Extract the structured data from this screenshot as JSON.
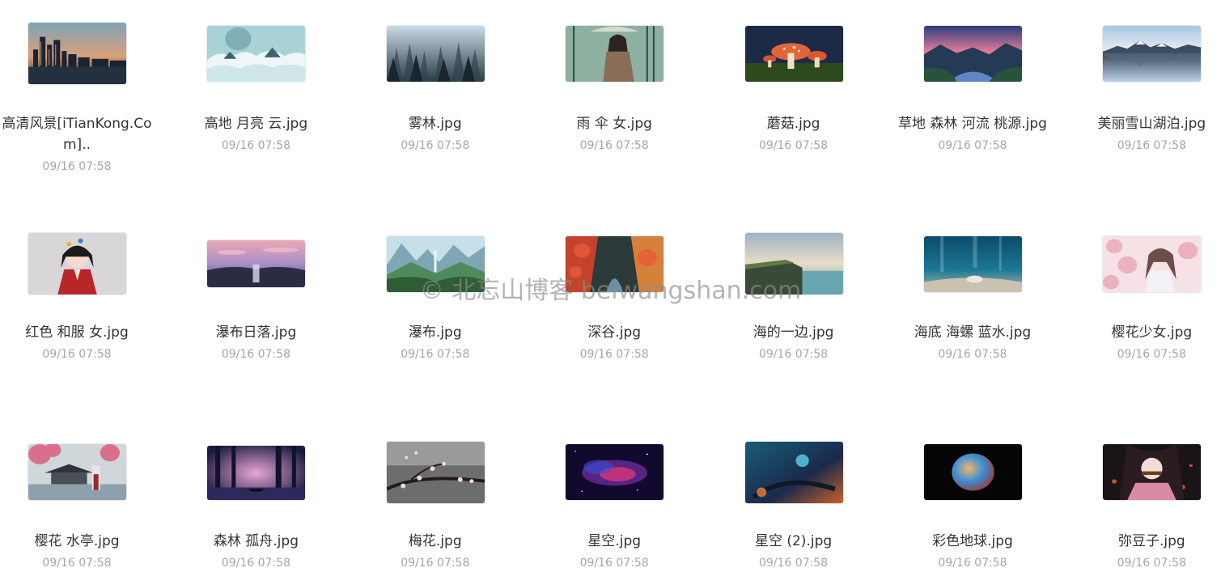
{
  "watermark": "© 北忘山博客 beiwangshan.com",
  "files": [
    {
      "name": "高清风景[iTianKong.Com]..",
      "date": "09/16 07:58",
      "thumb": "city-night-skyline"
    },
    {
      "name": "高地 月亮 云.jpg",
      "date": "09/16 07:58",
      "thumb": "moon-clouds"
    },
    {
      "name": "雾林.jpg",
      "date": "09/16 07:58",
      "thumb": "misty-forest"
    },
    {
      "name": "雨 伞 女.jpg",
      "date": "09/16 07:58",
      "thumb": "girl-umbrella"
    },
    {
      "name": "蘑菇.jpg",
      "date": "09/16 07:58",
      "thumb": "mushrooms"
    },
    {
      "name": "草地 森林 河流 桃源.jpg",
      "date": "09/16 07:58",
      "thumb": "meadow-river"
    },
    {
      "name": "美丽雪山湖泊.jpg",
      "date": "09/16 07:58",
      "thumb": "snow-lake"
    },
    {
      "name": "红色 和服 女.jpg",
      "date": "09/16 07:58",
      "thumb": "kimono-girl"
    },
    {
      "name": "瀑布日落.jpg",
      "date": "09/16 07:58",
      "thumb": "waterfall-sunset"
    },
    {
      "name": "瀑布.jpg",
      "date": "09/16 07:58",
      "thumb": "waterfall-valley"
    },
    {
      "name": "深谷.jpg",
      "date": "09/16 07:58",
      "thumb": "deep-valley"
    },
    {
      "name": "海的一边.jpg",
      "date": "09/16 07:58",
      "thumb": "sea-cliff"
    },
    {
      "name": "海底 海螺 蓝水.jpg",
      "date": "09/16 07:58",
      "thumb": "underwater-shell"
    },
    {
      "name": "樱花少女.jpg",
      "date": "09/16 07:58",
      "thumb": "sakura-girl"
    },
    {
      "name": "樱花 水亭.jpg",
      "date": "09/16 07:58",
      "thumb": "sakura-pavilion"
    },
    {
      "name": "森林 孤舟.jpg",
      "date": "09/16 07:58",
      "thumb": "forest-boat"
    },
    {
      "name": "梅花.jpg",
      "date": "09/16 07:58",
      "thumb": "plum-blossom"
    },
    {
      "name": "星空.jpg",
      "date": "09/16 07:58",
      "thumb": "nebula"
    },
    {
      "name": "星空 (2).jpg",
      "date": "09/16 07:58",
      "thumb": "space-planets"
    },
    {
      "name": "彩色地球.jpg",
      "date": "09/16 07:58",
      "thumb": "colorful-planet"
    },
    {
      "name": "弥豆子.jpg",
      "date": "09/16 07:58",
      "thumb": "nezuko"
    }
  ]
}
